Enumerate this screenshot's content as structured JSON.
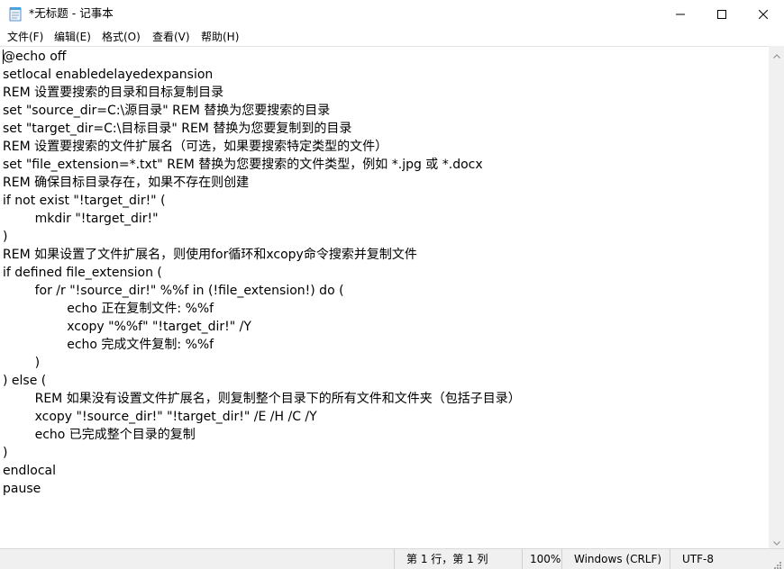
{
  "window": {
    "title": "*无标题 - 记事本",
    "icon": "notepad-icon",
    "controls": [
      "minimize-icon",
      "maximize-icon",
      "close-icon"
    ]
  },
  "menu": {
    "file": "文件(F)",
    "edit": "编辑(E)",
    "format": "格式(O)",
    "view": "查看(V)",
    "help": "帮助(H)"
  },
  "editor": {
    "content": "@echo off\nsetlocal enabledelayedexpansion\nREM 设置要搜索的目录和目标复制目录\nset \"source_dir=C:\\源目录\" REM 替换为您要搜索的目录\nset \"target_dir=C:\\目标目录\" REM 替换为您要复制到的目录\nREM 设置要搜索的文件扩展名（可选，如果要搜索特定类型的文件）\nset \"file_extension=*.txt\" REM 替换为您要搜索的文件类型，例如 *.jpg 或 *.docx\nREM 确保目标目录存在，如果不存在则创建\nif not exist \"!target_dir!\" (\n\tmkdir \"!target_dir!\"\n)\nREM 如果设置了文件扩展名，则使用for循环和xcopy命令搜索并复制文件\nif defined file_extension (\n\tfor /r \"!source_dir!\" %%f in (!file_extension!) do (\n\t\techo 正在复制文件: %%f\n\t\txcopy \"%%f\" \"!target_dir!\" /Y\n\t\techo 完成文件复制: %%f\n\t)\n) else (\n\tREM 如果没有设置文件扩展名，则复制整个目录下的所有文件和文件夹（包括子目录）\n\txcopy \"!source_dir!\" \"!target_dir!\" /E /H /C /Y\n\techo 已完成整个目录的复制\n)\nendlocal\npause"
  },
  "status": {
    "position": "第 1 行，第 1 列",
    "zoom": "100%",
    "line_ending": "Windows (CRLF)",
    "encoding": "UTF-8"
  },
  "colors": {
    "background": "#ffffff",
    "statusbar": "#f0f0f0",
    "scrollbar": "#f0f0f0"
  }
}
